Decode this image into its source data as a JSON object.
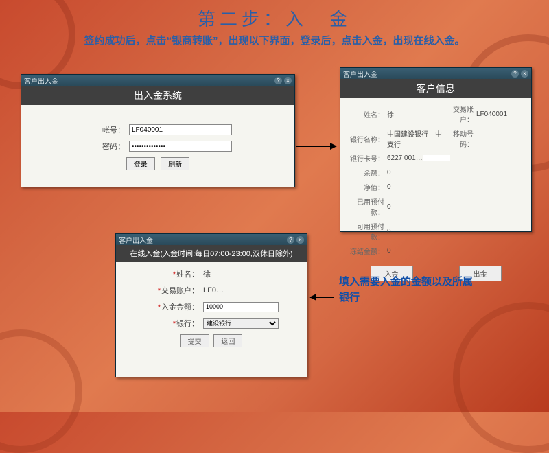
{
  "slide": {
    "title": "第二步：入　金",
    "subtitle": "签约成功后，点击“银商转账”，出现以下界面，登录后，点击入金，出现在线入金。"
  },
  "win1": {
    "tab": "客户出入金",
    "header": "出入金系统",
    "account_label": "帐号：",
    "account_value": "LF040001",
    "password_label": "密码：",
    "password_value": "••••••••••••••",
    "btn_login": "登录",
    "btn_refresh": "刷新"
  },
  "win2": {
    "tab": "客户出入金",
    "header": "客户信息",
    "name_label": "姓名：",
    "name_value": "徐",
    "acct_label": "交易账户：",
    "acct_value": "LF040001",
    "bank_label": "银行名称：",
    "bank_value": "中国建设银行　中支行",
    "mobile_label": "移动号码：",
    "mobile_value": "",
    "card_label": "银行卡号：",
    "card_value": "6227 001…",
    "balance_label": "余额：",
    "balance_value": "0",
    "net_label": "净值：",
    "net_value": "0",
    "used_label": "已用预付款：",
    "used_value": "0",
    "avail_label": "可用预付款：",
    "avail_value": "0",
    "frozen_label": "冻结金额：",
    "frozen_value": "0",
    "btn_in": "入金",
    "btn_out": "出金"
  },
  "win3": {
    "tab": "客户出入金",
    "header": "在线入金(入金时间:每日07:00-23:00,双休日除外)",
    "name_label": "姓名：",
    "name_value": "徐",
    "acct_label": "交易账户：",
    "acct_value": "LF0…",
    "amount_label": "入金金额：",
    "amount_value": "10000",
    "bank_label": "银行：",
    "bank_value": "建设银行",
    "btn_submit": "提交",
    "btn_back": "返回"
  },
  "annot1": "填入需要入金的金额以及所属银行"
}
